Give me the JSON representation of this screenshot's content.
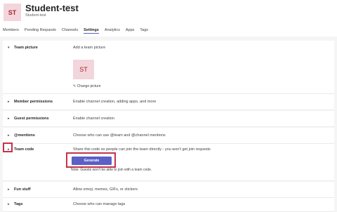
{
  "header": {
    "avatar_initials": "ST",
    "team_name": "Student-test",
    "more_icon": "···",
    "team_subtitle": "Student-test",
    "tabs": [
      "Members",
      "Pending Requests",
      "Channels",
      "Settings",
      "Analytics",
      "Apps",
      "Tags"
    ],
    "active_tab": "Settings"
  },
  "settings": {
    "team_picture": {
      "label": "Team picture",
      "desc": "Add a team picture",
      "initials": "ST",
      "change": "Change picture"
    },
    "member_permissions": {
      "label": "Member permissions",
      "desc": "Enable channel creation, adding apps, and more"
    },
    "guest_permissions": {
      "label": "Guest permissions",
      "desc": "Enable channel creation"
    },
    "mentions": {
      "label": "@mentions",
      "desc": "Choose who can use @team and @channel mentions"
    },
    "team_code": {
      "label": "Team code",
      "desc": "Share this code so people can join the team directly - you won't get join requests",
      "button": "Generate",
      "note": "Note: Guests won't be able to join with a team code."
    },
    "fun_stuff": {
      "label": "Fun stuff",
      "desc": "Allow emoji, memes, GIFs, or stickers"
    },
    "tags": {
      "label": "Tags",
      "desc": "Choose who can manage tags"
    }
  },
  "colors": {
    "accent": "#5b5fc7",
    "highlight": "#c4314b",
    "avatar_bg": "#f2d6dc"
  },
  "icons": {
    "chevron": "chevron-icon",
    "edit": "pencil-icon"
  }
}
